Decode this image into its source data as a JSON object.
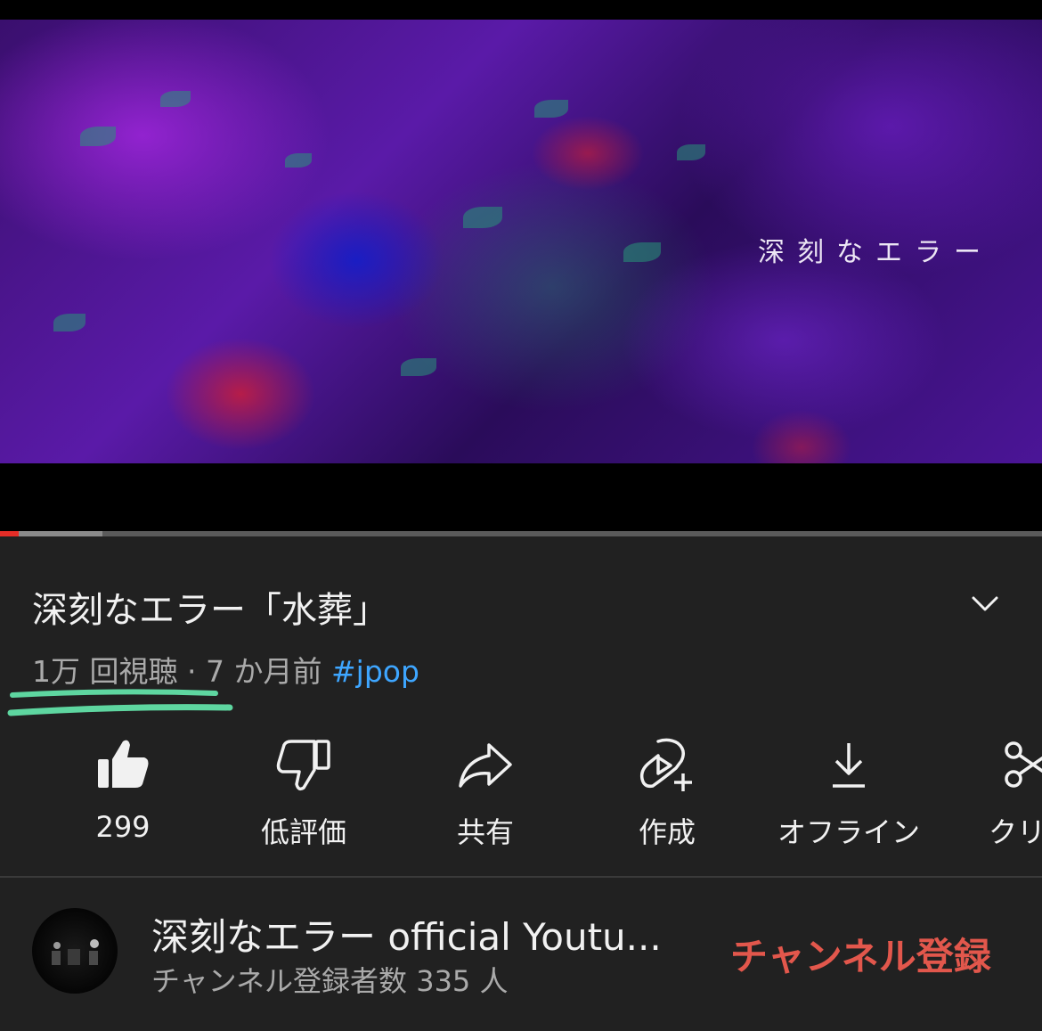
{
  "player": {
    "overlay_text": "深刻なエラー",
    "progress_played": 0.018,
    "progress_buffered": 0.098
  },
  "video": {
    "title": "深刻なエラー「水葬」",
    "views": "1万 回視聴",
    "separator": "·",
    "age": "7 か月前",
    "hashtag": "#jpop"
  },
  "actions": [
    {
      "label": "299",
      "icon": "thumbs-up-icon"
    },
    {
      "label": "低評価",
      "icon": "thumbs-down-icon"
    },
    {
      "label": "共有",
      "icon": "share-icon"
    },
    {
      "label": "作成",
      "icon": "create-icon"
    },
    {
      "label": "オフライン",
      "icon": "download-icon"
    },
    {
      "label": "クリッ",
      "icon": "clip-icon"
    }
  ],
  "channel": {
    "name": "深刻なエラー official Youtu...",
    "subscribers": "チャンネル登録者数 335 人",
    "subscribe_label": "チャンネル登録"
  },
  "colors": {
    "background": "#212121",
    "secondary_text": "#aaaaaa",
    "hashtag": "#3ea6ff",
    "subscribe": "#e2574c",
    "progress": "#e52d27",
    "annotation": "#5ed6a0"
  }
}
